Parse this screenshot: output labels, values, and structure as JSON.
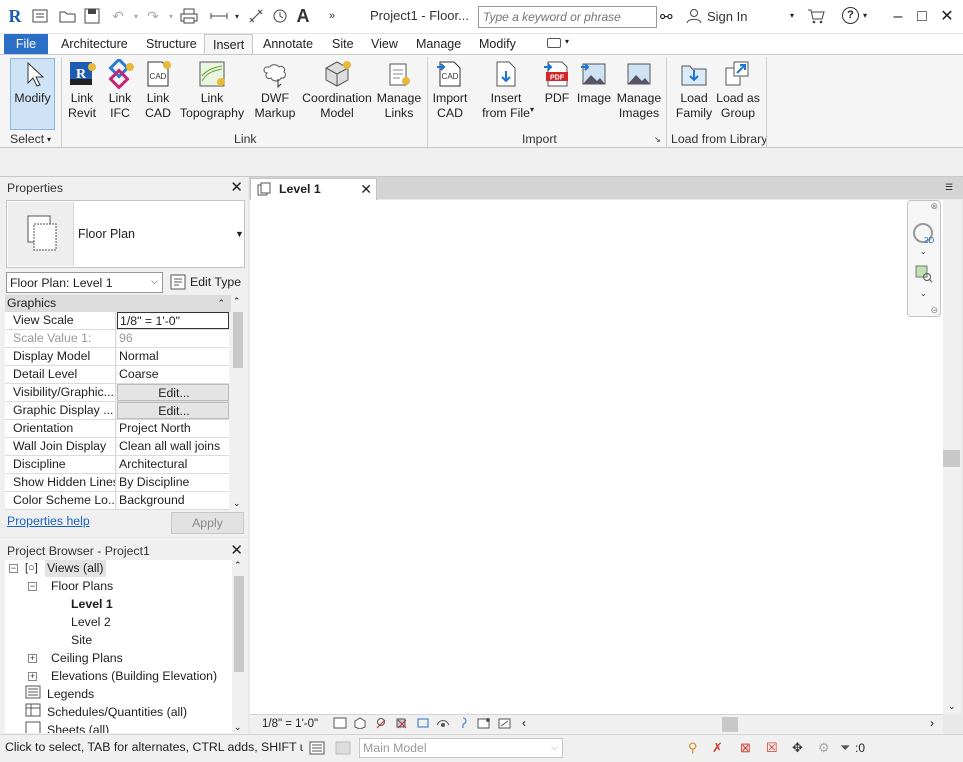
{
  "title_bar": {
    "app_logo": "R",
    "title": "Project1 - Floor...",
    "search_placeholder": "Type a keyword or phrase",
    "sign_in": "Sign In"
  },
  "ribbon_tabs": [
    "File",
    "Architecture",
    "Structure",
    "Insert",
    "Annotate",
    "Site",
    "View",
    "Manage",
    "Modify"
  ],
  "ribbon": {
    "select_panel": {
      "modify": "Modify",
      "label": "Select"
    },
    "link_panel": {
      "label": "Link",
      "buttons": [
        {
          "l1": "Link",
          "l2": "Revit"
        },
        {
          "l1": "Link",
          "l2": "IFC"
        },
        {
          "l1": "Link",
          "l2": "CAD"
        },
        {
          "l1": "Link",
          "l2": "Topography"
        },
        {
          "l1": "DWF",
          "l2": "Markup"
        },
        {
          "l1": "Coordination",
          "l2": "Model"
        },
        {
          "l1": "Manage",
          "l2": "Links"
        }
      ]
    },
    "import_panel": {
      "label": "Import",
      "buttons": [
        {
          "l1": "Import",
          "l2": "CAD"
        },
        {
          "l1": "Insert",
          "l2": "from File"
        },
        {
          "l1": "PDF",
          "l2": ""
        },
        {
          "l1": "Image",
          "l2": ""
        },
        {
          "l1": "Manage",
          "l2": "Images"
        }
      ]
    },
    "library_panel": {
      "label": "Load from Library",
      "buttons": [
        {
          "l1": "Load",
          "l2": "Family"
        },
        {
          "l1": "Load as",
          "l2": "Group"
        }
      ]
    }
  },
  "properties": {
    "title": "Properties",
    "type_name": "Floor Plan",
    "view_selector": "Floor Plan: Level 1",
    "edit_type": "Edit Type",
    "group": "Graphics",
    "rows": [
      {
        "key": "View Scale",
        "value": "1/8\" = 1'-0\""
      },
      {
        "key": "Scale Value    1:",
        "value": "96"
      },
      {
        "key": "Display Model",
        "value": "Normal"
      },
      {
        "key": "Detail Level",
        "value": "Coarse"
      },
      {
        "key": "Visibility/Graphic...",
        "value": "Edit..."
      },
      {
        "key": "Graphic Display ...",
        "value": "Edit..."
      },
      {
        "key": "Orientation",
        "value": "Project North"
      },
      {
        "key": "Wall Join Display",
        "value": "Clean all wall joins"
      },
      {
        "key": "Discipline",
        "value": "Architectural"
      },
      {
        "key": "Show Hidden Lines",
        "value": "By Discipline"
      },
      {
        "key": "Color Scheme Lo...",
        "value": "Background"
      }
    ],
    "help_link": "Properties help",
    "apply": "Apply"
  },
  "project_browser": {
    "title": "Project Browser - Project1",
    "nodes": {
      "views": "Views (all)",
      "floor_plans": "Floor Plans",
      "level1": "Level 1",
      "level2": "Level 2",
      "site": "Site",
      "ceiling_plans": "Ceiling Plans",
      "elevations": "Elevations (Building Elevation)",
      "legends": "Legends",
      "schedules": "Schedules/Quantities (all)",
      "sheets": "Sheets (all)"
    }
  },
  "view_tab": {
    "label": "Level 1"
  },
  "view_control": {
    "scale": "1/8\" = 1'-0\""
  },
  "status_bar": {
    "message": "Click to select, TAB for alternates, CTRL adds, SHIFT unselects.",
    "workset": "Main Model",
    "filter_count": ":0"
  }
}
